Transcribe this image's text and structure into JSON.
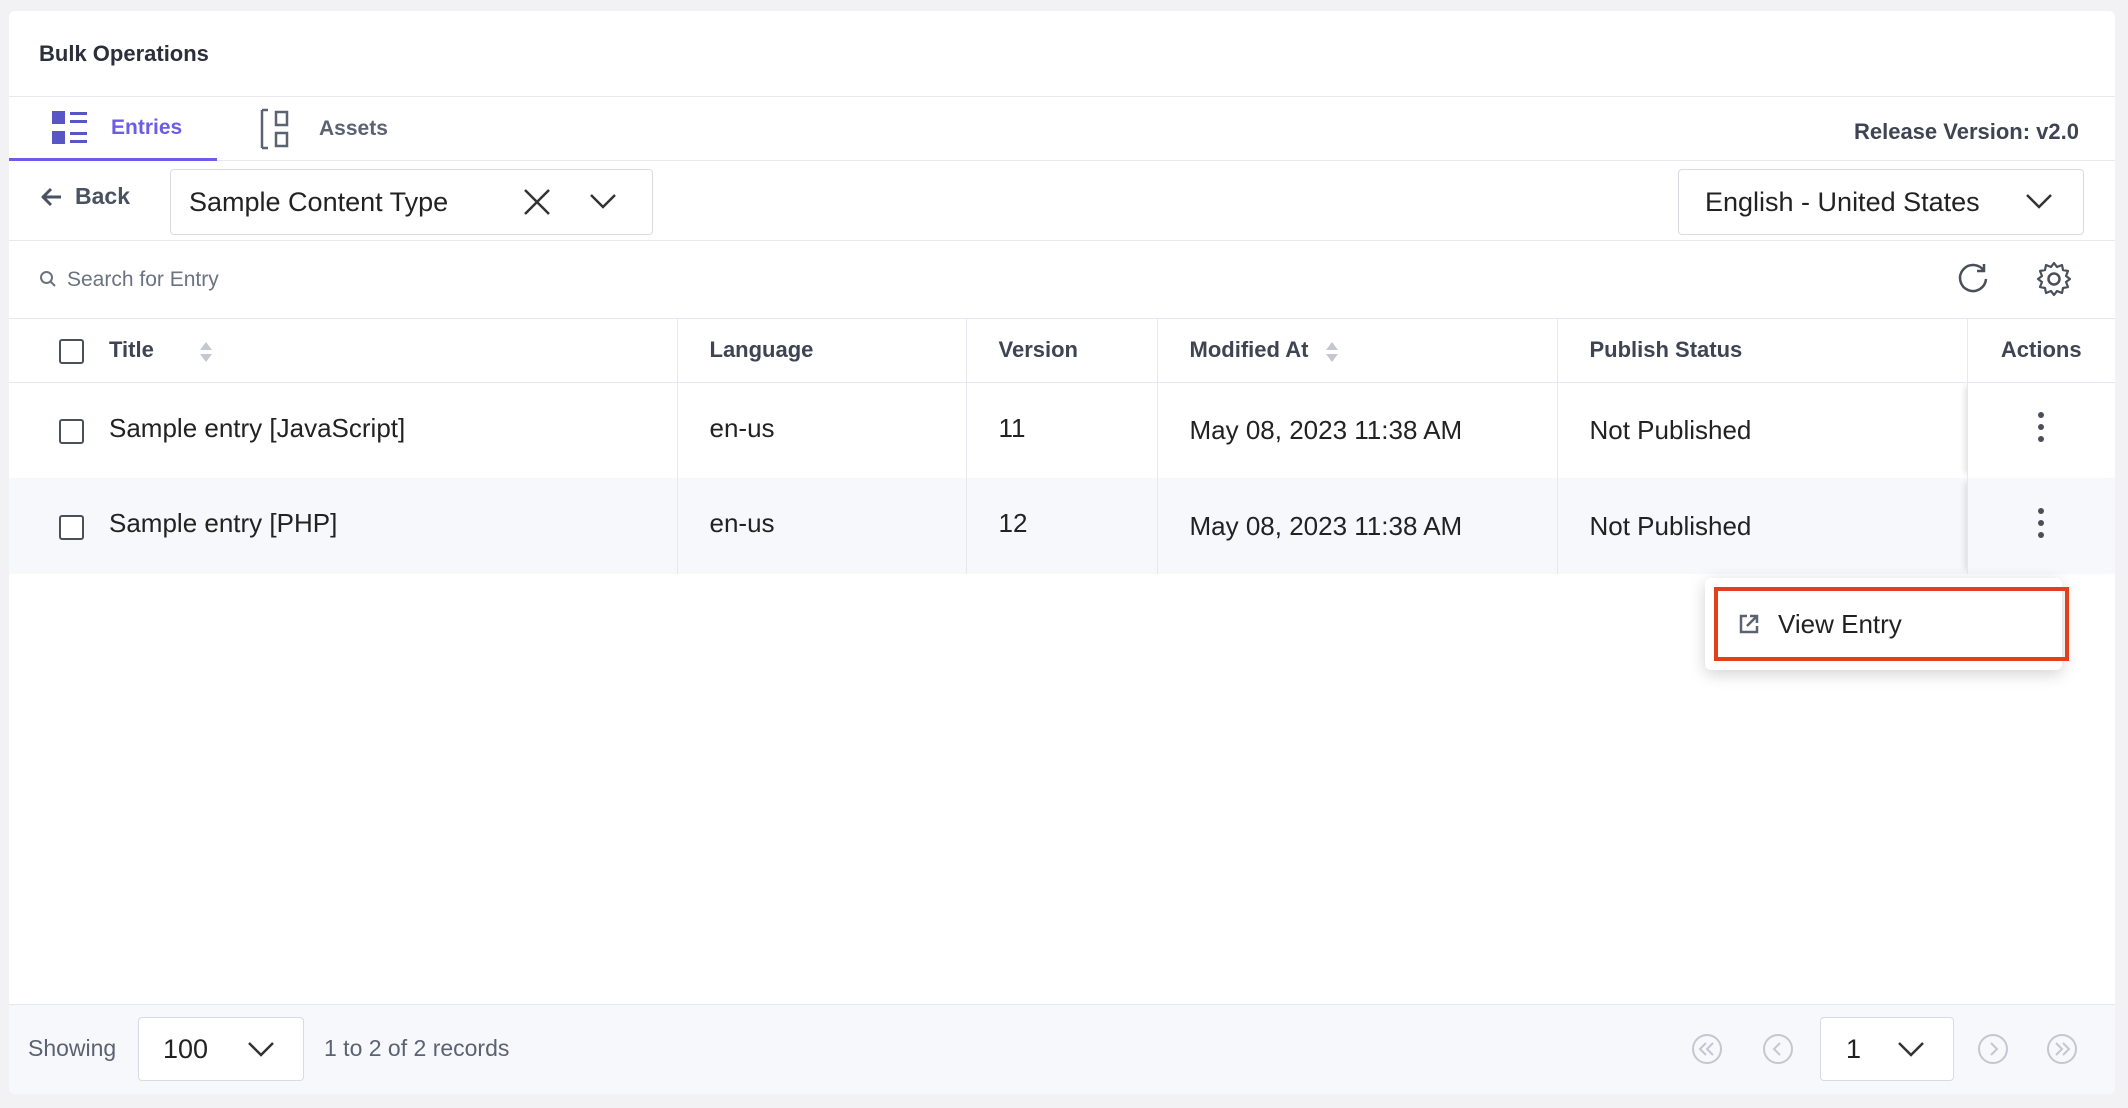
{
  "header": {
    "title": "Bulk Operations"
  },
  "tabs": [
    {
      "label": "Entries",
      "icon": "list-grid-icon",
      "active": true
    },
    {
      "label": "Assets",
      "icon": "assets-icon",
      "active": false
    }
  ],
  "release": {
    "label": "Release Version: v2.0"
  },
  "filters": {
    "back_label": "Back",
    "content_type": "Sample Content Type",
    "locale": "English - United States"
  },
  "search": {
    "placeholder": "Search for Entry"
  },
  "table": {
    "columns": [
      "Title",
      "Language",
      "Version",
      "Modified At",
      "Publish Status",
      "Actions"
    ],
    "rows": [
      {
        "title": "Sample entry [JavaScript]",
        "language": "en-us",
        "version": "11",
        "modified": "May 08, 2023 11:38 AM",
        "status": "Not Published"
      },
      {
        "title": "Sample entry [PHP]",
        "language": "en-us",
        "version": "12",
        "modified": "May 08, 2023 11:38 AM",
        "status": "Not Published"
      }
    ]
  },
  "menu": {
    "view_entry": "View Entry"
  },
  "footer": {
    "showing_label": "Showing",
    "per_page": "100",
    "records_text": "1 to 2 of 2 records",
    "current_page": "1"
  },
  "colors": {
    "accent": "#6c5ce7",
    "highlight": "#e2401c"
  }
}
